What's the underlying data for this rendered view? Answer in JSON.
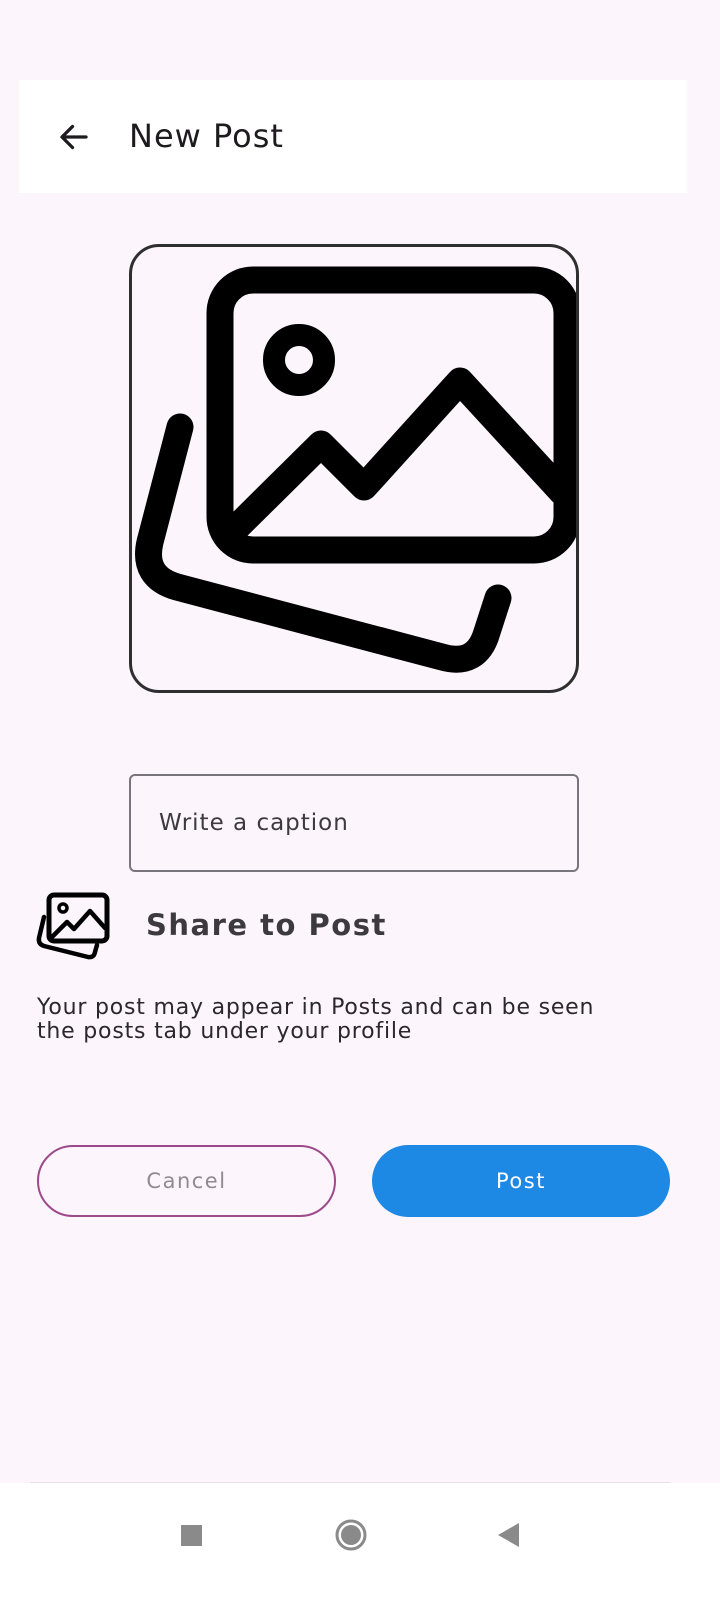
{
  "app_bar": {
    "title": "New Post",
    "back_icon": "arrow-left-icon"
  },
  "image_picker": {
    "icon": "images-icon"
  },
  "caption": {
    "placeholder": "Write a caption",
    "value": ""
  },
  "share": {
    "icon": "images-icon",
    "label": "Share to Post",
    "description": "Your post may appear in Posts and can be seen the posts tab under your profile"
  },
  "actions": {
    "cancel_label": "Cancel",
    "post_label": "Post"
  },
  "colors": {
    "background": "#fcf5fc",
    "primary": "#1e88e5",
    "cancel_border": "#9c4a8a"
  },
  "nav": {
    "recents_icon": "square-icon",
    "home_icon": "circle-icon",
    "back_icon": "triangle-back-icon"
  }
}
